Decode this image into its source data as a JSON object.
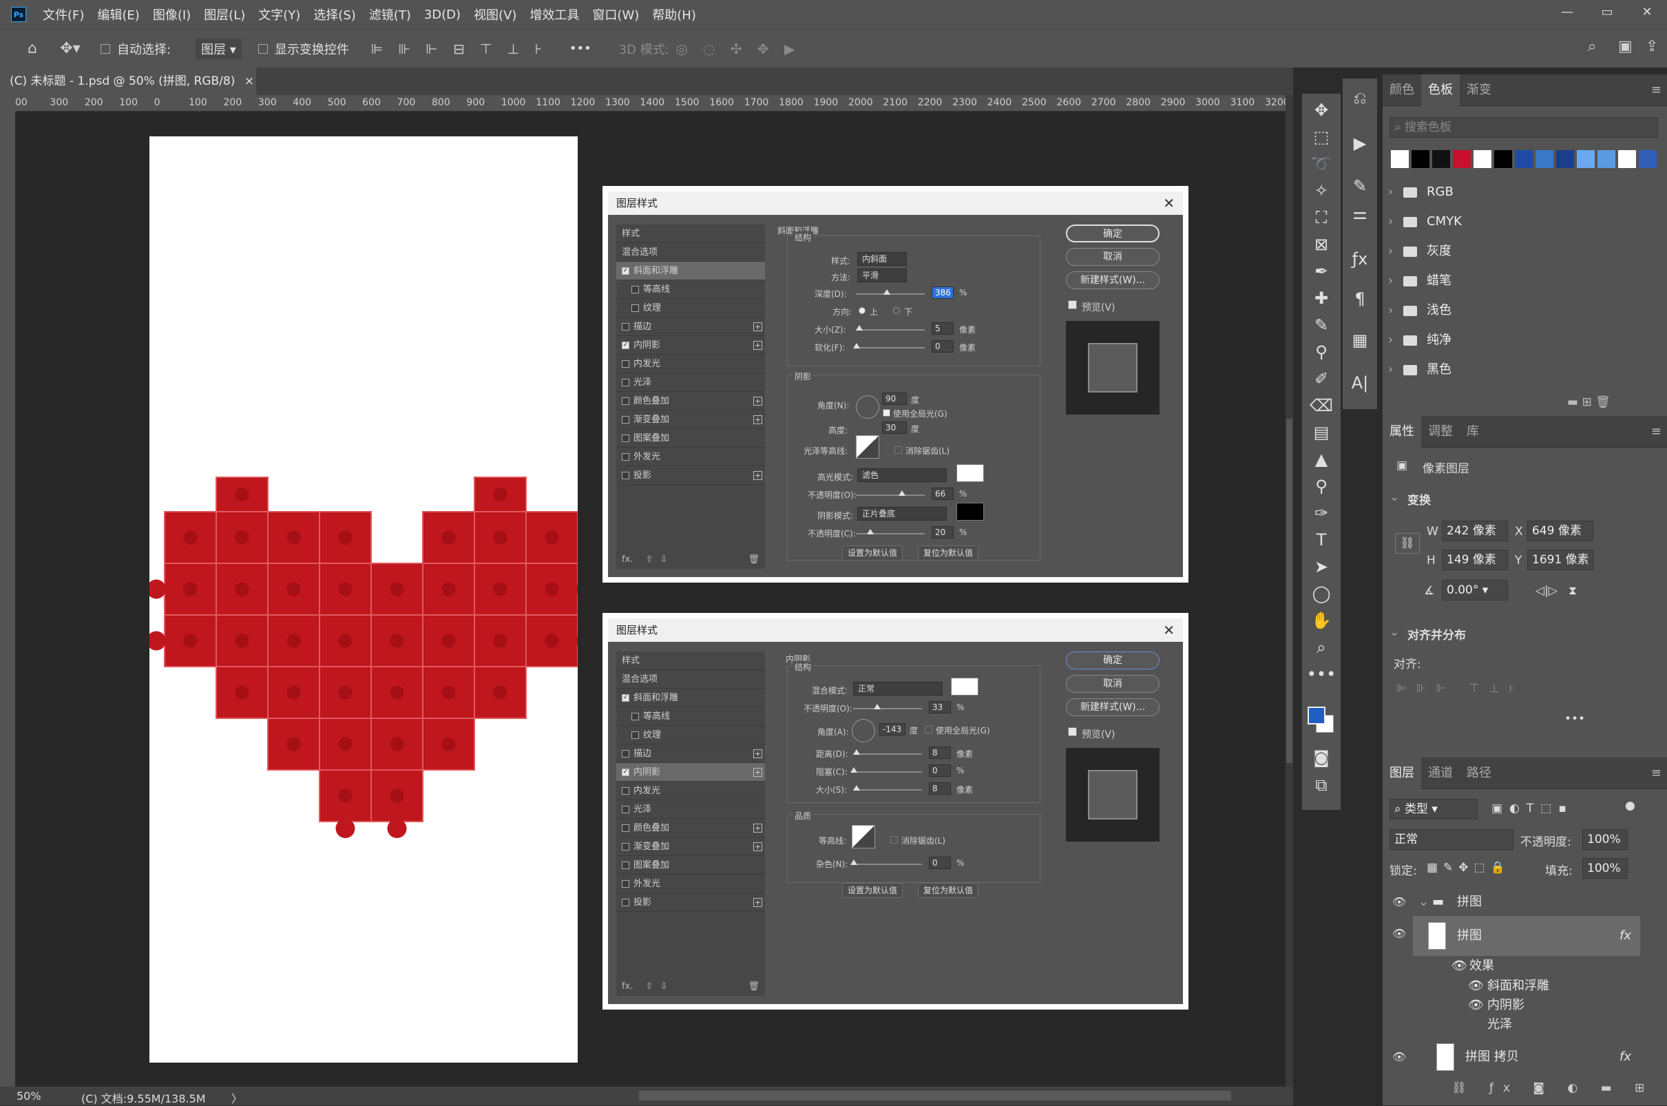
{
  "app": {
    "logo": "Ps"
  },
  "menu": [
    "文件(F)",
    "编辑(E)",
    "图像(I)",
    "图层(L)",
    "文字(Y)",
    "选择(S)",
    "滤镜(T)",
    "3D(D)",
    "视图(V)",
    "增效工具",
    "窗口(W)",
    "帮助(H)"
  ],
  "window_controls": [
    "minimize-icon",
    "restore-icon",
    "close-icon"
  ],
  "options": {
    "auto_select_label": "自动选择:",
    "auto_select_value": "图层",
    "transform_label": "显示变换控件",
    "mode3d_label": "3D 模式:",
    "more": "•••"
  },
  "tab": {
    "title": "(C) 未标题 - 1.psd @ 50% (拼图, RGB/8)",
    "close": "×"
  },
  "ruler_h": [
    "00",
    "300",
    "200",
    "100",
    "0",
    "100",
    "200",
    "300",
    "400",
    "500",
    "600",
    "700",
    "800",
    "900",
    "1000",
    "1100",
    "1200",
    "1300",
    "1400",
    "1500",
    "1600",
    "1700",
    "1800",
    "1900",
    "2000",
    "2100",
    "2200",
    "2300",
    "2400",
    "2500",
    "2600",
    "2700",
    "2800",
    "2900",
    "3000",
    "3100",
    "3200"
  ],
  "status": {
    "zoom": "50%",
    "doc": "(C) 文档:9.55M/138.5M",
    "arrow": "〉"
  },
  "dialog1": {
    "title": "图层样式",
    "styles": [
      {
        "label": "样式",
        "type": "head"
      },
      {
        "label": "混合选项",
        "type": "head"
      },
      {
        "label": "斜面和浮雕",
        "checked": true,
        "sel": true
      },
      {
        "label": "等高线",
        "checked": false,
        "indent": true
      },
      {
        "label": "纹理",
        "checked": false,
        "indent": true
      },
      {
        "label": "描边",
        "checked": false,
        "plus": true
      },
      {
        "label": "内阴影",
        "checked": true,
        "plus": true
      },
      {
        "label": "内发光",
        "checked": false
      },
      {
        "label": "光泽",
        "checked": false
      },
      {
        "label": "颜色叠加",
        "checked": false,
        "plus": true
      },
      {
        "label": "渐变叠加",
        "checked": false,
        "plus": true
      },
      {
        "label": "图案叠加",
        "checked": false
      },
      {
        "label": "外发光",
        "checked": false
      },
      {
        "label": "投影",
        "checked": false,
        "plus": true
      }
    ],
    "section": "斜面和浮雕",
    "sub": "结构",
    "style_label": "样式:",
    "style_val": "内斜面",
    "method_label": "方法:",
    "method_val": "平滑",
    "depth_label": "深度(D):",
    "depth_val": "386",
    "pct": "%",
    "dir_label": "方向:",
    "dir_up": "上",
    "dir_down": "下",
    "size_label": "大小(Z):",
    "size_val": "5",
    "px": "像素",
    "soften_label": "软化(F):",
    "soften_val": "0",
    "shadow_label": "阴影",
    "angle_label": "角度(N):",
    "angle_val": "90",
    "deg": "度",
    "global_label": "使用全局光(G)",
    "alt_label": "高度:",
    "alt_val": "30",
    "gloss_label": "光泽等高线:",
    "aa_label": "消除锯齿(L)",
    "hl_mode_label": "高光模式:",
    "hl_mode_val": "滤色",
    "hl_op_label": "不透明度(O):",
    "hl_op_val": "66",
    "sh_mode_label": "阴影模式:",
    "sh_mode_val": "正片叠底",
    "sh_op_label": "不透明度(C):",
    "sh_op_val": "20",
    "btn_default": "设置为默认值",
    "btn_reset": "复位为默认值",
    "ok": "确定",
    "cancel": "取消",
    "new_style": "新建样式(W)...",
    "preview": "预览(V)",
    "fx": "fx."
  },
  "dialog2": {
    "title": "图层样式",
    "section": "内阴影",
    "sub": "结构",
    "blend_label": "混合模式:",
    "blend_val": "正常",
    "op_label": "不透明度(O):",
    "op_val": "33",
    "angle_label": "角度(A):",
    "angle_val": "-143",
    "deg": "度",
    "global_label": "使用全局光(G)",
    "dist_label": "距离(D):",
    "dist_val": "8",
    "choke_label": "阻塞(C):",
    "choke_val": "0",
    "size_label": "大小(S):",
    "size_val": "8",
    "quality_label": "品质",
    "contour_label": "等高线:",
    "aa_label": "消除锯齿(L)",
    "noise_label": "杂色(N):",
    "noise_val": "0",
    "sel_index": 6
  },
  "swatches": {
    "tabs": [
      "颜色",
      "色板",
      "渐变"
    ],
    "search": "搜索色板",
    "colors": [
      "#ffffff",
      "#000000",
      "#111111",
      "#c8102e",
      "#ffffff",
      "#000000",
      "#1f4aa8",
      "#3a78c8",
      "#1a3f8a",
      "#6aa8f0",
      "#5a9ae0",
      "#ffffff",
      "#2f5fb8"
    ],
    "folders": [
      "RGB",
      "CMYK",
      "灰度",
      "蜡笔",
      "浅色",
      "纯净",
      "黑色"
    ]
  },
  "properties": {
    "tabs": [
      "属性",
      "调整",
      "库"
    ],
    "kind": "像素图层",
    "transform": "变换",
    "w_label": "W",
    "w": "242 像素",
    "x_label": "X",
    "x": "649 像素",
    "h_label": "H",
    "h": "149 像素",
    "y_label": "Y",
    "y": "1691 像素",
    "rot": "0.00°",
    "align_head": "对齐并分布",
    "align": "对齐:",
    "more": "•••"
  },
  "layers": {
    "tabs": [
      "图层",
      "通道",
      "路径"
    ],
    "filter": "类型",
    "blend": "正常",
    "opacity_label": "不透明度:",
    "opacity": "100%",
    "lock_label": "锁定:",
    "fill_label": "填充:",
    "fill": "100%",
    "group": "拼图",
    "layer1": "拼图",
    "effects": "效果",
    "eff1": "斜面和浮雕",
    "eff2": "内阴影",
    "eff3": "光泽",
    "layer2": "拼图 拷贝",
    "fx": "fx"
  },
  "colors": {
    "puzzle": "#c0161d",
    "accent": "#2d72d9",
    "fg": "#1f5fc4"
  }
}
